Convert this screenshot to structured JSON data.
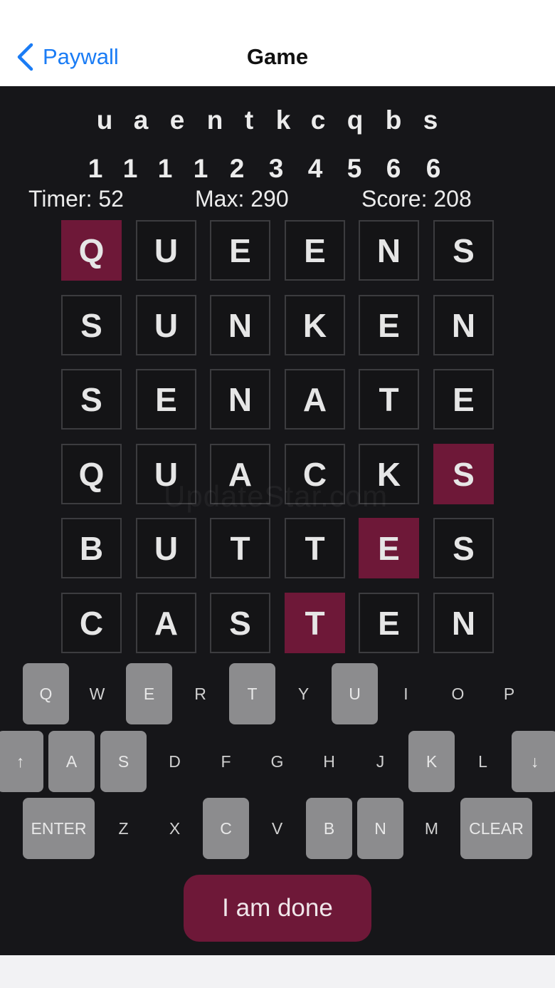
{
  "nav": {
    "back_label": "Paywall",
    "title": "Game"
  },
  "letters": [
    "u",
    "a",
    "e",
    "n",
    "t",
    "k",
    "c",
    "q",
    "b",
    "s"
  ],
  "letter_values": [
    "1",
    "1",
    "1",
    "1",
    "2",
    "3",
    "4",
    "5",
    "6",
    "6"
  ],
  "stats": {
    "timer": "Timer: 52",
    "max": "Max: 290",
    "score": "Score: 208"
  },
  "grid": [
    [
      "Q",
      "U",
      "E",
      "E",
      "N",
      "S"
    ],
    [
      "S",
      "U",
      "N",
      "K",
      "E",
      "N"
    ],
    [
      "S",
      "E",
      "N",
      "A",
      "T",
      "E"
    ],
    [
      "Q",
      "U",
      "A",
      "C",
      "K",
      "S"
    ],
    [
      "B",
      "U",
      "T",
      "T",
      "E",
      "S"
    ],
    [
      "C",
      "A",
      "S",
      "T",
      "E",
      "N"
    ]
  ],
  "highlighted": [
    [
      0,
      0
    ],
    [
      3,
      5
    ],
    [
      4,
      4
    ],
    [
      5,
      3
    ]
  ],
  "keyboard": {
    "row1": [
      "Q",
      "W",
      "E",
      "R",
      "T",
      "Y",
      "U",
      "I",
      "O",
      "P"
    ],
    "row2": [
      "↑",
      "A",
      "S",
      "D",
      "F",
      "G",
      "H",
      "J",
      "K",
      "L",
      "↓"
    ],
    "row3": [
      "ENTER",
      "Z",
      "X",
      "C",
      "V",
      "B",
      "N",
      "M",
      "CLEAR"
    ],
    "used_keys": [
      "Q",
      "E",
      "T",
      "U",
      "↑",
      "A",
      "S",
      "K",
      "↓",
      "ENTER",
      "C",
      "B",
      "N",
      "CLEAR"
    ]
  },
  "done_label": "I am done",
  "watermark": "UpdateStar.com",
  "colors": {
    "accent": "#6e1838",
    "link": "#1a7cf5",
    "background": "#161619",
    "key_used": "#8c8c8e"
  }
}
